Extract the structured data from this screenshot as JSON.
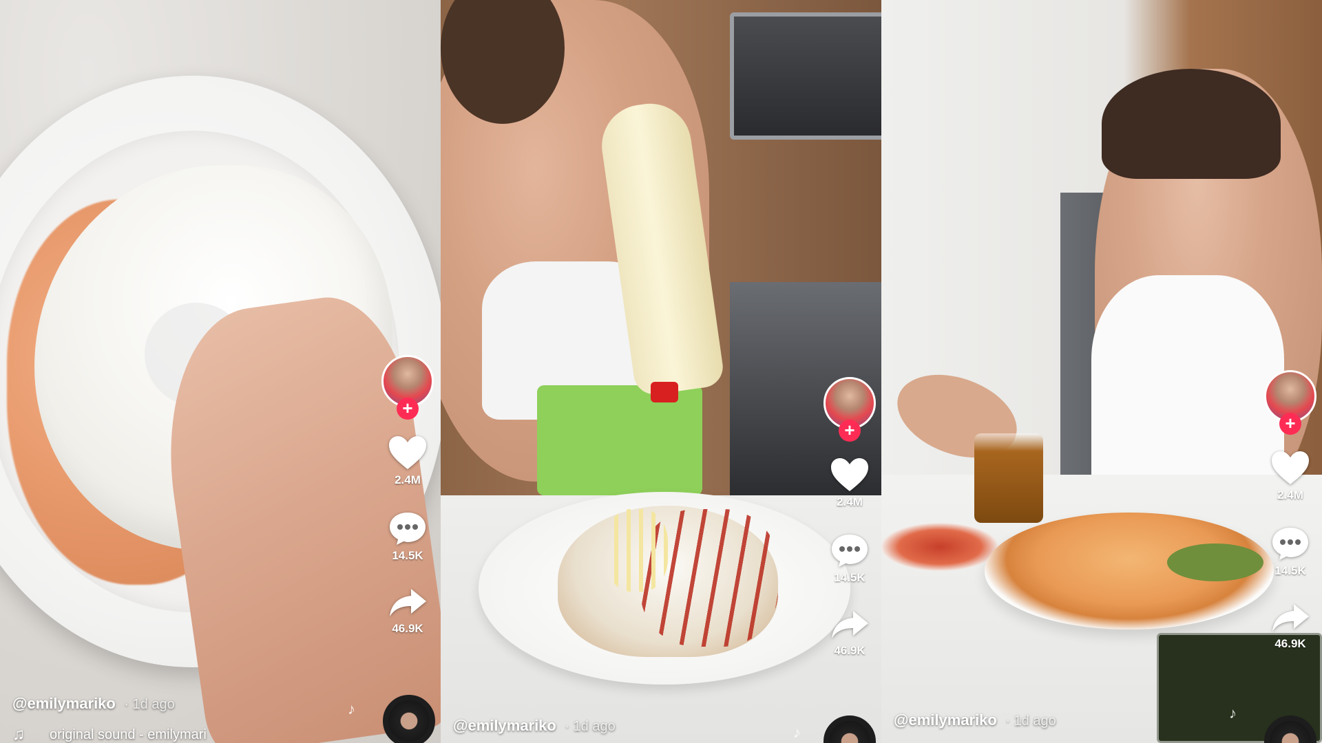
{
  "panels": [
    {
      "username": "@emilymariko",
      "age": "1d ago",
      "sound": "original sound - emilymari",
      "likes": "2.4M",
      "comments": "14.5K",
      "shares": "46.9K"
    },
    {
      "username": "@emilymariko",
      "age": "1d ago",
      "likes": "2.4M",
      "comments": "14.5K",
      "shares": "46.9K"
    },
    {
      "username": "@emilymariko",
      "age": "1d ago",
      "likes": "2.4M",
      "comments": "14.5K",
      "shares": "46.9K"
    }
  ],
  "icons": {
    "follow": "plus-icon",
    "like": "heart-icon",
    "comment": "comment-bubble-icon",
    "share": "share-arrow-icon",
    "sound": "music-note-icon",
    "disc": "sound-disc-icon"
  },
  "colors": {
    "follow_badge": "#fe2c55",
    "overlay_text": "#ffffff"
  }
}
